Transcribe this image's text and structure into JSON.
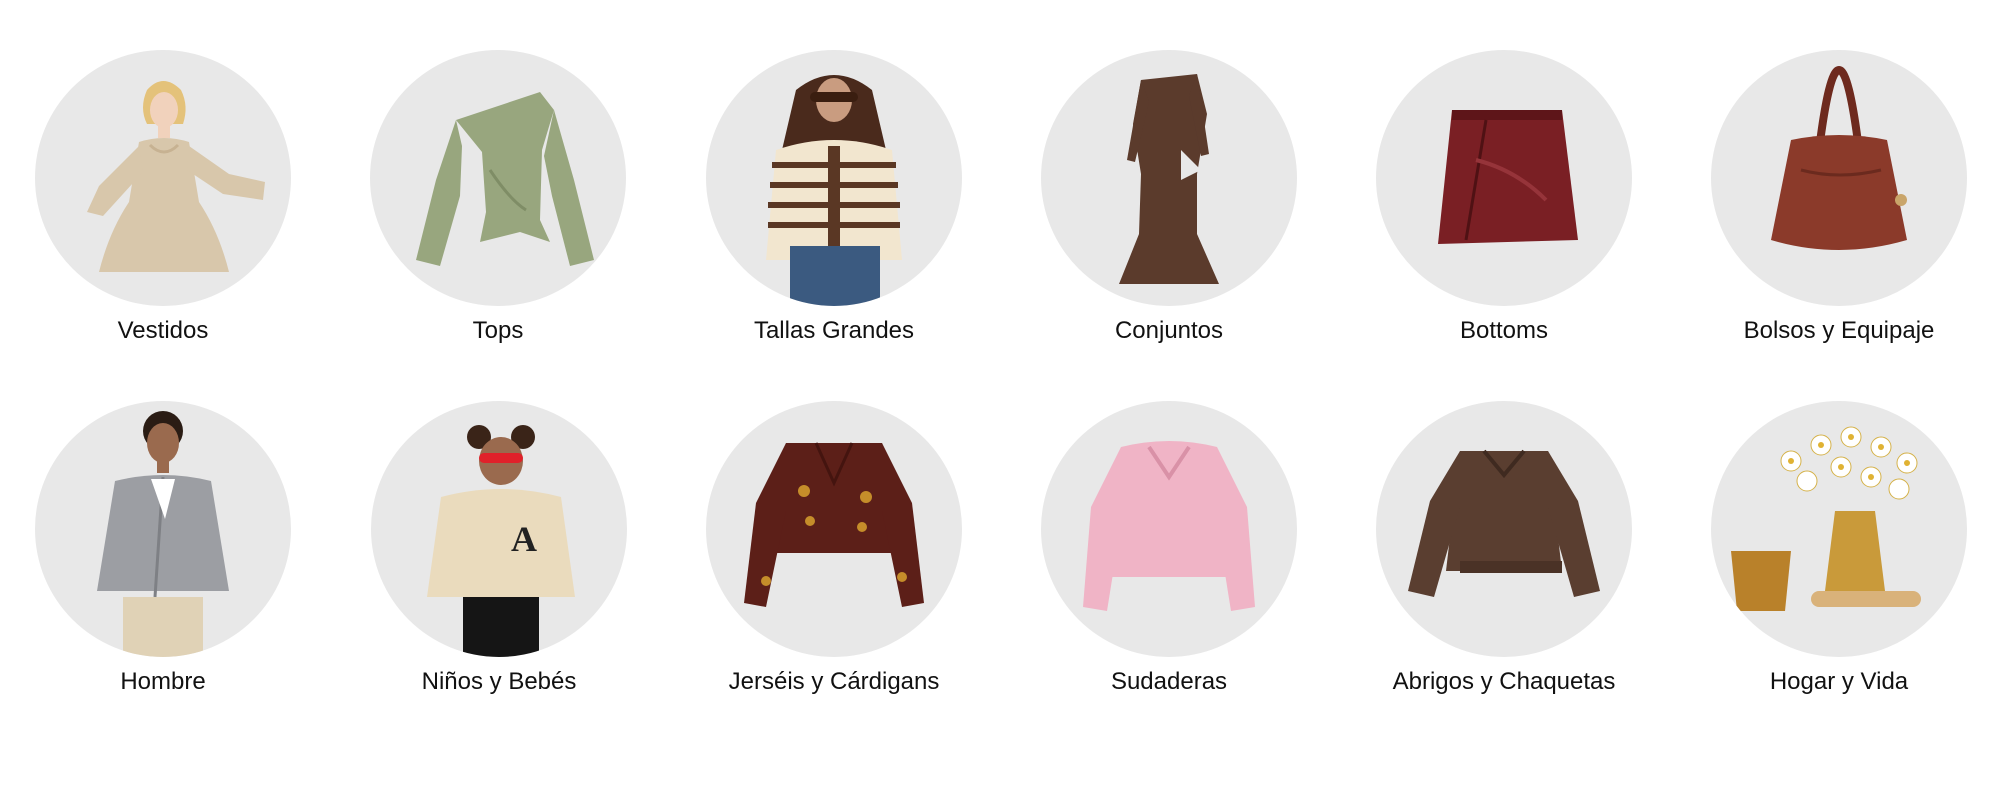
{
  "categories": [
    {
      "label": "Vestidos",
      "icon": "dress-model-icon"
    },
    {
      "label": "Tops",
      "icon": "off-shoulder-top-icon"
    },
    {
      "label": "Tallas Grandes",
      "icon": "striped-cardigan-model-icon"
    },
    {
      "label": "Conjuntos",
      "icon": "maxi-dress-icon"
    },
    {
      "label": "Bottoms",
      "icon": "leather-skirt-icon"
    },
    {
      "label": "Bolsos y Equipaje",
      "icon": "handbag-icon"
    },
    {
      "label": "Hombre",
      "icon": "man-cardigan-model-icon"
    },
    {
      "label": "Niños y Bebés",
      "icon": "kid-sweatshirt-model-icon"
    },
    {
      "label": "Jerséis y Cárdigans",
      "icon": "embroidered-cardigan-icon"
    },
    {
      "label": "Sudaderas",
      "icon": "pink-sweatshirt-icon"
    },
    {
      "label": "Abrigos y Chaquetas",
      "icon": "brown-jacket-icon"
    },
    {
      "label": "Hogar y Vida",
      "icon": "flower-vase-icon"
    }
  ],
  "colors": {
    "circle_bg": "#e8e8e8",
    "text": "#111111"
  }
}
